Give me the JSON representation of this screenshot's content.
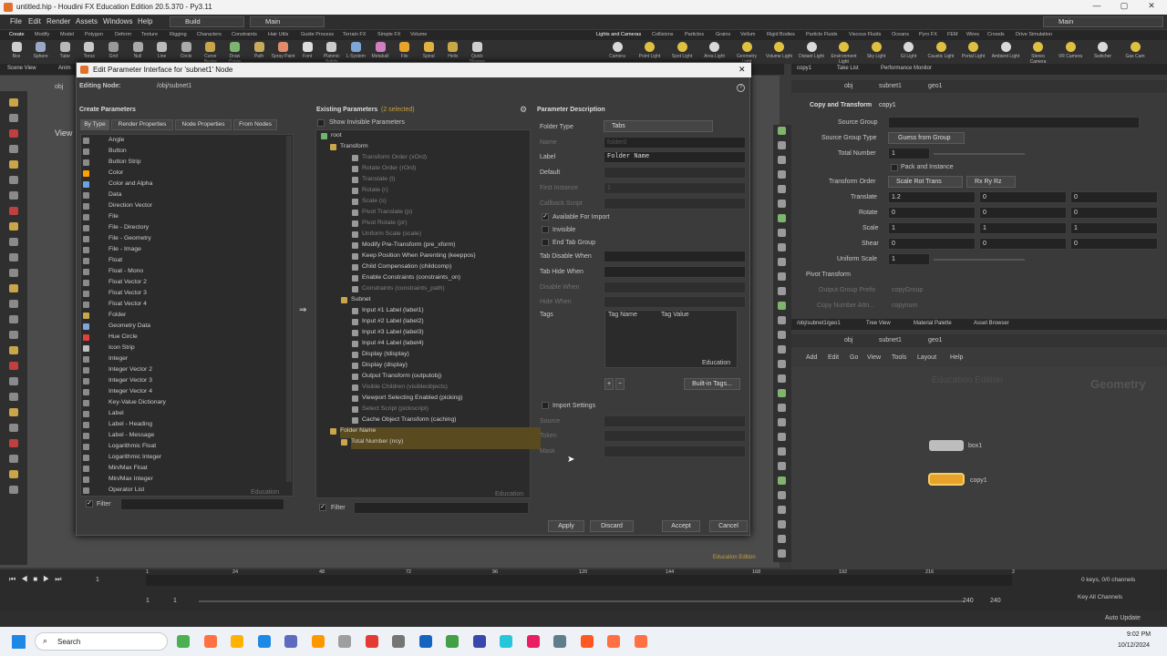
{
  "window": {
    "title": "untitled.hip - Houdini FX Education Edition 20.5.370 - Py3.11",
    "min": "—",
    "max": "▢",
    "close": "✕"
  },
  "menubar": {
    "items": [
      "File",
      "Edit",
      "Render",
      "Assets",
      "Windows",
      "Help"
    ],
    "desktop_combo": "Build",
    "desktop_combo2": "Main",
    "right_combo": "Main"
  },
  "shelf_tabs_left": [
    "Create",
    "Modify",
    "Model",
    "Polygon",
    "Deform",
    "Texture",
    "Rigging",
    "Characters",
    "Constraints",
    "Hair Utils",
    "Guide Process",
    "Terrain FX",
    "Simple FX",
    "Volume"
  ],
  "shelf_tabs_right": [
    "Lights and Cameras",
    "Collisions",
    "Particles",
    "Grains",
    "Vellum",
    "Rigid Bodies",
    "Particle Fluids",
    "Viscous Fluids",
    "Oceans",
    "Pyro FX",
    "FEM",
    "Wires",
    "Crowds",
    "Drive Simulation"
  ],
  "shelf_tools_left": [
    "Box",
    "Sphere",
    "Tube",
    "Torus",
    "Grid",
    "Null",
    "Line",
    "Circle",
    "Curve Bezier",
    "Draw Curve",
    "Path",
    "Spray Paint",
    "Font",
    "Platonic Solids",
    "L-System",
    "Metaball",
    "File",
    "Spiral",
    "Helix",
    "Quick Shapes"
  ],
  "shelf_tools_right": [
    "Camera",
    "Point Light",
    "Spot Light",
    "Area Light",
    "Geometry Light",
    "Volume Light",
    "Distant Light",
    "Environment Light",
    "Sky Light",
    "GI Light",
    "Caustic Light",
    "Portal Light",
    "Ambient Light",
    "Stereo Camera",
    "VR Camera",
    "Switcher",
    "Gas Cam"
  ],
  "scene_tabs": [
    "Scene View",
    "Anim"
  ],
  "viewport": {
    "path": "obj",
    "view_label": "View",
    "watermark": "Education Edition"
  },
  "dialog": {
    "title": "Edit Parameter Interface for 'subnet1' Node",
    "editing_label": "Editing Node:",
    "editing_value": "/obj/subnet1",
    "create_header": "Create Parameters",
    "create_tabs": [
      "By Type",
      "Render Properties",
      "Node Properties",
      "From Nodes"
    ],
    "param_types": [
      "Angle",
      "Button",
      "Button Strip",
      "Color",
      "Color and Alpha",
      "Data",
      "Direction Vector",
      "File",
      "File - Directory",
      "File - Geometry",
      "File - Image",
      "Float",
      "Float - Mono",
      "Float Vector 2",
      "Float Vector 3",
      "Float Vector 4",
      "Folder",
      "Geometry Data",
      "Hue Circle",
      "Icon Strip",
      "Integer",
      "Integer Vector 2",
      "Integer Vector 3",
      "Integer Vector 4",
      "Key-Value Dictionary",
      "Label",
      "Label - Heading",
      "Label - Message",
      "Logarithmic Float",
      "Logarithmic Integer",
      "Min/Max Float",
      "Min/Max Integer",
      "Operator List"
    ],
    "create_watermark": "Education",
    "filter_label": "Filter",
    "existing_header": "Existing Parameters",
    "existing_selected": "(2 selected)",
    "show_invisible": "Show Invisible Parameters",
    "tree": {
      "root": "root",
      "transform": "Transform",
      "transform_children": [
        "Transform Order (xOrd)",
        "Rotate Order (rOrd)",
        "Translate (t)",
        "Rotate (r)",
        "Scale (s)",
        "Pivot Translate (p)",
        "Pivot Rotate (pr)",
        "Uniform Scale (scale)",
        "Modify Pre-Transform (pre_xform)",
        "Keep Position When Parenting (keeppos)",
        "Child Compensation (childcomp)",
        "Enable Constraints (constraints_on)",
        "Constraints (constraints_path)"
      ],
      "subnet": "Subnet",
      "subnet_children": [
        "Input #1 Label (label1)",
        "Input #2 Label (label2)",
        "Input #3 Label (label3)",
        "Input #4 Label (label4)",
        "Display (tdisplay)",
        "Display (display)",
        "Output Transform (outputobj)",
        "Visible Children (visibleobjects)",
        "Viewport Selecting Enabled (picking)",
        "Select Script (pickscript)",
        "Cache Object Transform (caching)"
      ],
      "folder_name": "Folder Name",
      "total_number": "Total Number (ncy)"
    },
    "existing_watermark": "Education",
    "pd_header": "Parameter Description",
    "folder_type_label": "Folder Type",
    "folder_type_value": "Tabs",
    "name_label": "Name",
    "name_value": "folder0",
    "label_label": "Label",
    "label_value": "Folder Name",
    "default_label": "Default",
    "first_instance_label": "First Instance",
    "first_instance_value": "1",
    "callback_label": "Callback Script",
    "available_import": "Available For Import",
    "invisible": "Invisible",
    "end_tab_group": "End Tab Group",
    "tab_disable_when": "Tab Disable When",
    "tab_hide_when": "Tab Hide When",
    "disable_when": "Disable When",
    "hide_when": "Hide When",
    "tags_label": "Tags",
    "tag_name_col": "Tag Name",
    "tag_value_col": "Tag Value",
    "tags_watermark": "Education",
    "builtin_tags": "Built-in Tags...",
    "import_settings": "Import Settings",
    "source_label": "Source",
    "token_label": "Token",
    "mask_label": "Mask",
    "buttons": {
      "apply": "Apply",
      "discard": "Discard",
      "accept": "Accept",
      "cancel": "Cancel"
    }
  },
  "right_panel": {
    "tabs": [
      "copy1",
      "Take List",
      "Performance Monitor"
    ],
    "path": [
      "obj",
      "subnet1",
      "geo1"
    ],
    "node_type": "Copy and Transform",
    "node_name": "copy1",
    "params": {
      "source_group": "Source Group",
      "source_group_type": "Source Group Type",
      "source_group_type_value": "Guess from Group",
      "total_number": "Total Number",
      "total_number_value": "1",
      "pack_instance": "Pack and Instance",
      "transform_order": "Transform Order",
      "transform_order_value": "Scale Rot Trans",
      "rot_order_value": "Rx Ry Rz",
      "translate": "Translate",
      "translate_values": [
        "1.2",
        "0",
        "0"
      ],
      "rotate": "Rotate",
      "rotate_values": [
        "0",
        "0",
        "0"
      ],
      "scale": "Scale",
      "scale_values": [
        "1",
        "1",
        "1"
      ],
      "shear": "Shear",
      "shear_values": [
        "0",
        "0",
        "0"
      ],
      "uniform_scale": "Uniform Scale",
      "uniform_scale_value": "1",
      "pivot_transform": "Pivot Transform",
      "output_group_prefix": "Output Group Prefix",
      "output_group_prefix_value": "copyGroup",
      "copy_number_attr": "Copy Number Attri...",
      "copy_number_attr_value": "copynum"
    },
    "net_tabs": [
      "/obj/subnet1/geo1",
      "Tree View",
      "Material Palette",
      "Asset Browser"
    ],
    "net_path": [
      "obj",
      "subnet1",
      "geo1"
    ],
    "net_menu": [
      "Add",
      "Edit",
      "Go",
      "View",
      "Tools",
      "Layout",
      "Help"
    ],
    "net_watermark": "Education Edition",
    "net_context": "Geometry",
    "nodes": [
      "box1",
      "copy1"
    ]
  },
  "timeline": {
    "frame": "1",
    "ticks": [
      "1",
      "24",
      "48",
      "72",
      "96",
      "120",
      "144",
      "168",
      "192",
      "216",
      "2"
    ],
    "start": "1",
    "start2": "1",
    "end": "240",
    "end2": "240",
    "keys_label": "0 keys, 0/0 channels",
    "key_all": "Key All Channels",
    "auto_update": "Auto Update"
  },
  "taskbar": {
    "search": "Search",
    "time": "9:02 PM",
    "date": "10/12/2024"
  },
  "colors": {
    "accent": "#c8a13a",
    "selected_row": "#5a4a1f",
    "checkmark": "#e0e0e0"
  }
}
